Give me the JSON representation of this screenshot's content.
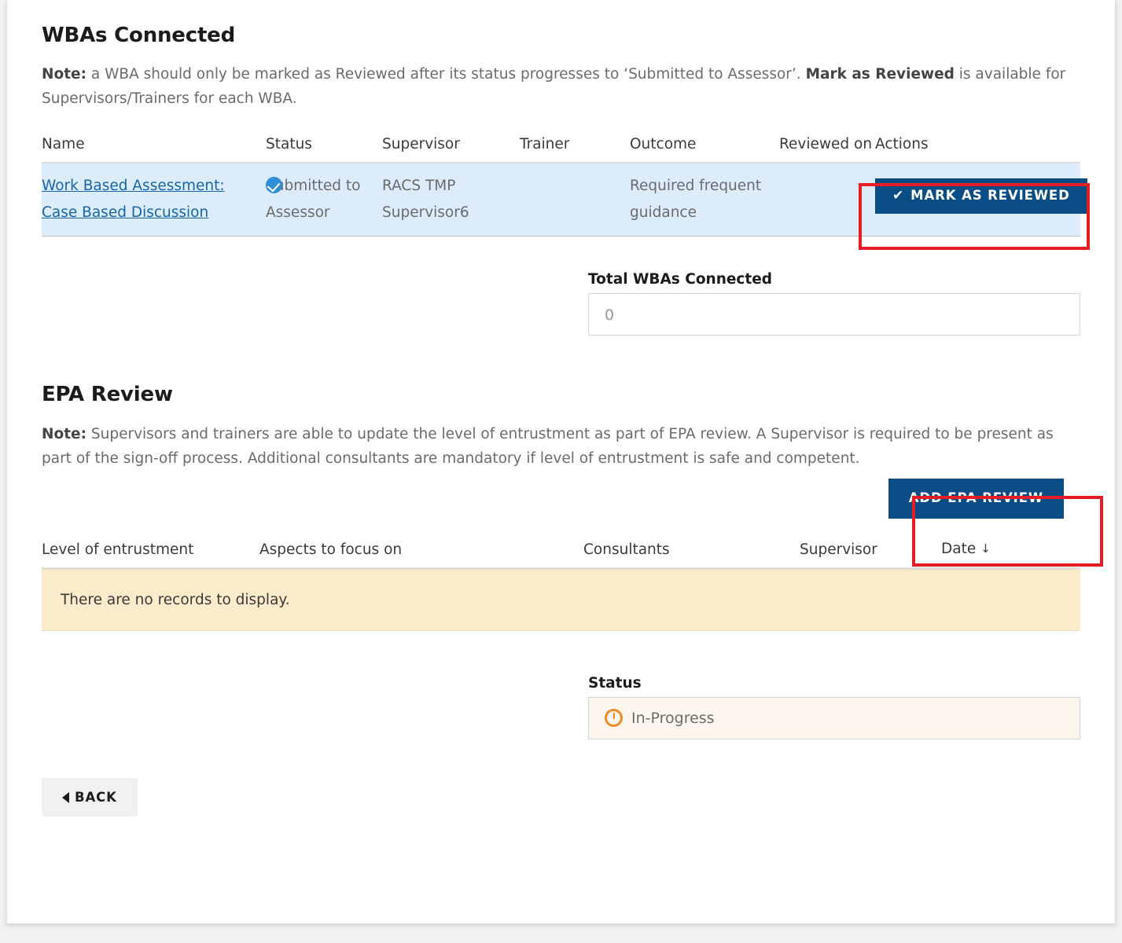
{
  "wbas_section": {
    "title": "WBAs Connected",
    "note_prefix": "Note:",
    "note_part1": " a WBA should only be marked as Reviewed after its status progresses to ‘Submitted to Assessor’. ",
    "note_bold": "Mark as Reviewed",
    "note_part2": " is available for Supervisors/Trainers for each WBA.",
    "columns": [
      "Name",
      "Status",
      "Supervisor",
      "Trainer",
      "Outcome",
      "Reviewed on",
      "Actions"
    ],
    "row": {
      "name": "Work Based Assessment: Case Based Discussion",
      "status": "Submitted to Assessor",
      "status_icon": "check-circle-icon",
      "supervisor": "RACS TMP Supervisor6",
      "trainer": "",
      "outcome": "Required frequent guidance",
      "reviewed_on": "",
      "action_label": "MARK AS REVIEWED",
      "action_icon": "checkmark-icon"
    },
    "total_label": "Total WBAs Connected",
    "total_value": "0"
  },
  "epa_section": {
    "title": "EPA Review",
    "note_prefix": "Note:",
    "note_text": " Supervisors and trainers are able to update the level of entrustment as part of EPA review. A Supervisor is required to be present as part of the sign-off process. Additional consultants are mandatory if level of entrustment is safe and competent.",
    "add_button_label": "ADD EPA REVIEW",
    "columns": [
      "Level of entrustment",
      "Aspects to focus on",
      "Consultants",
      "Supervisor",
      "Date"
    ],
    "sort_column": "Date",
    "sort_arrow": "↓",
    "empty_message": "There are no records to display.",
    "status_label": "Status",
    "status_value": "In-Progress",
    "status_icon": "in-progress-spinner-icon"
  },
  "footer": {
    "back_label": "BACK",
    "back_icon": "triangle-left-icon"
  },
  "colors": {
    "primary_button": "#0a4d85",
    "highlight_border": "#e81c24",
    "row_highlight": "#dcecfb",
    "empty_banner": "#faecca",
    "status_banner": "#fdf6ec",
    "status_icon": "#ef8b28",
    "link": "#1565a8"
  }
}
